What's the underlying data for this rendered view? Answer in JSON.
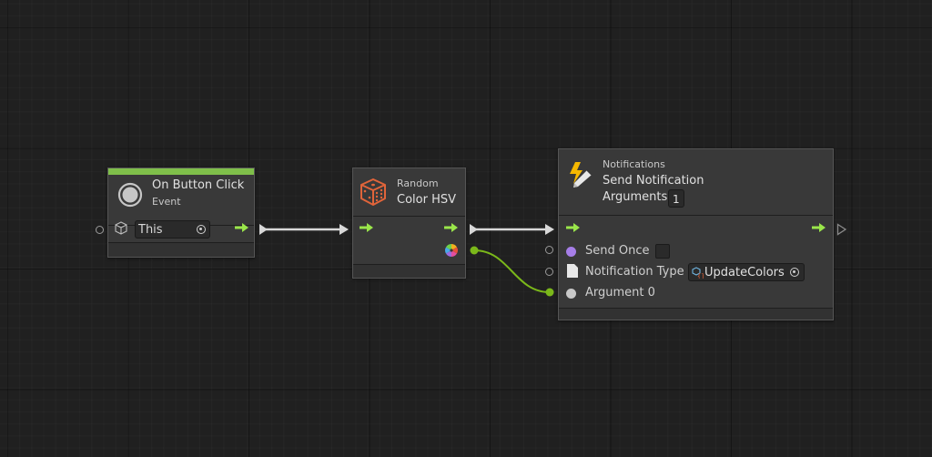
{
  "canvas": {
    "background": "#202020"
  },
  "colors": {
    "flow": "#9ae64a",
    "event_header": "#7fbf4a",
    "wire_value": "#7bb81a",
    "wire_flow": "#d8d8d8",
    "dice": "#e0643a",
    "lightning": "#f5b800",
    "send_once_port": "#a67ee8",
    "argument_port": "#c8c8c8"
  },
  "nodes": {
    "on_button_click": {
      "title": "On Button Click",
      "subtitle": "Event",
      "icon": "button-circle-icon",
      "target_field": {
        "value": "This",
        "icon": "cube-icon"
      }
    },
    "random_color": {
      "category": "Random",
      "title": "Color HSV",
      "icon": "dice-icon",
      "output_icon": "color-wheel-icon"
    },
    "send_notification": {
      "category": "Notifications",
      "title": "Send Notification",
      "arguments_label": "Arguments",
      "arguments_value": "1",
      "icon": "lightning-pencil-icon",
      "inputs": [
        {
          "label": "Send Once",
          "type": "checkbox",
          "checked": false
        },
        {
          "label": "Notification Type",
          "type": "object-field",
          "value": "UpdateColors"
        },
        {
          "label": "Argument 0",
          "type": "value"
        }
      ]
    }
  }
}
